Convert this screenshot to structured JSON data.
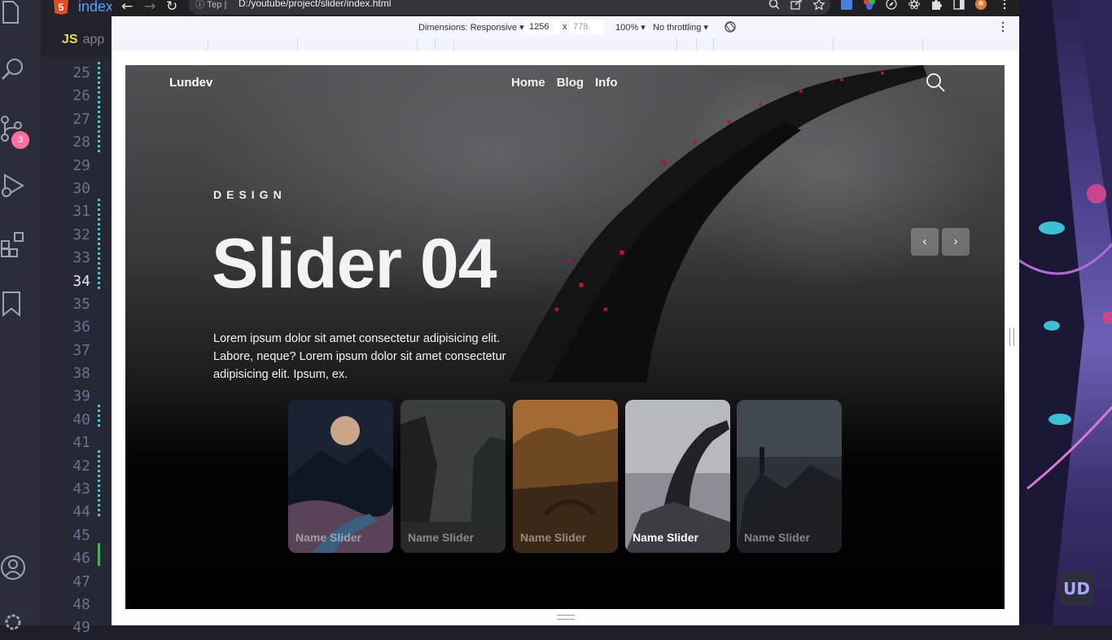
{
  "editor": {
    "file_tab": "index",
    "js_tab": {
      "lang": "JS",
      "name": "app"
    },
    "line_numbers": [
      "25",
      "26",
      "27",
      "28",
      "29",
      "30",
      "31",
      "32",
      "33",
      "34",
      "35",
      "36",
      "37",
      "38",
      "39",
      "40",
      "41",
      "42",
      "43",
      "44",
      "45",
      "46",
      "47",
      "48",
      "49"
    ],
    "active_line": "34",
    "source_control_badge": "3"
  },
  "browser": {
    "site_info": "Тер",
    "address": "D:/youtube/project/slider/index.html"
  },
  "devtools": {
    "dimensions_label": "Dimensions: Responsive",
    "width": "1256",
    "times": "x",
    "height": "778",
    "zoom": "100%",
    "throttling": "No throttling"
  },
  "page": {
    "logo": "Lundev",
    "nav": [
      "Home",
      "Blog",
      "Info"
    ],
    "eyebrow": "DESIGN",
    "headline": "Slider 04",
    "description": "Lorem ipsum dolor sit amet consectetur adipisicing elit. Labore, neque? Lorem ipsum dolor sit amet consectetur adipisicing elit. Ipsum, ex.",
    "prev_icon": "‹",
    "next_icon": "›",
    "thumbnails": [
      {
        "name": "Name Slider",
        "active": false
      },
      {
        "name": "Name Slider",
        "active": false
      },
      {
        "name": "Name Slider",
        "active": false
      },
      {
        "name": "Name Slider",
        "active": true
      },
      {
        "name": "Name Slider",
        "active": false
      }
    ]
  },
  "desktop": {
    "logo": "UD"
  }
}
